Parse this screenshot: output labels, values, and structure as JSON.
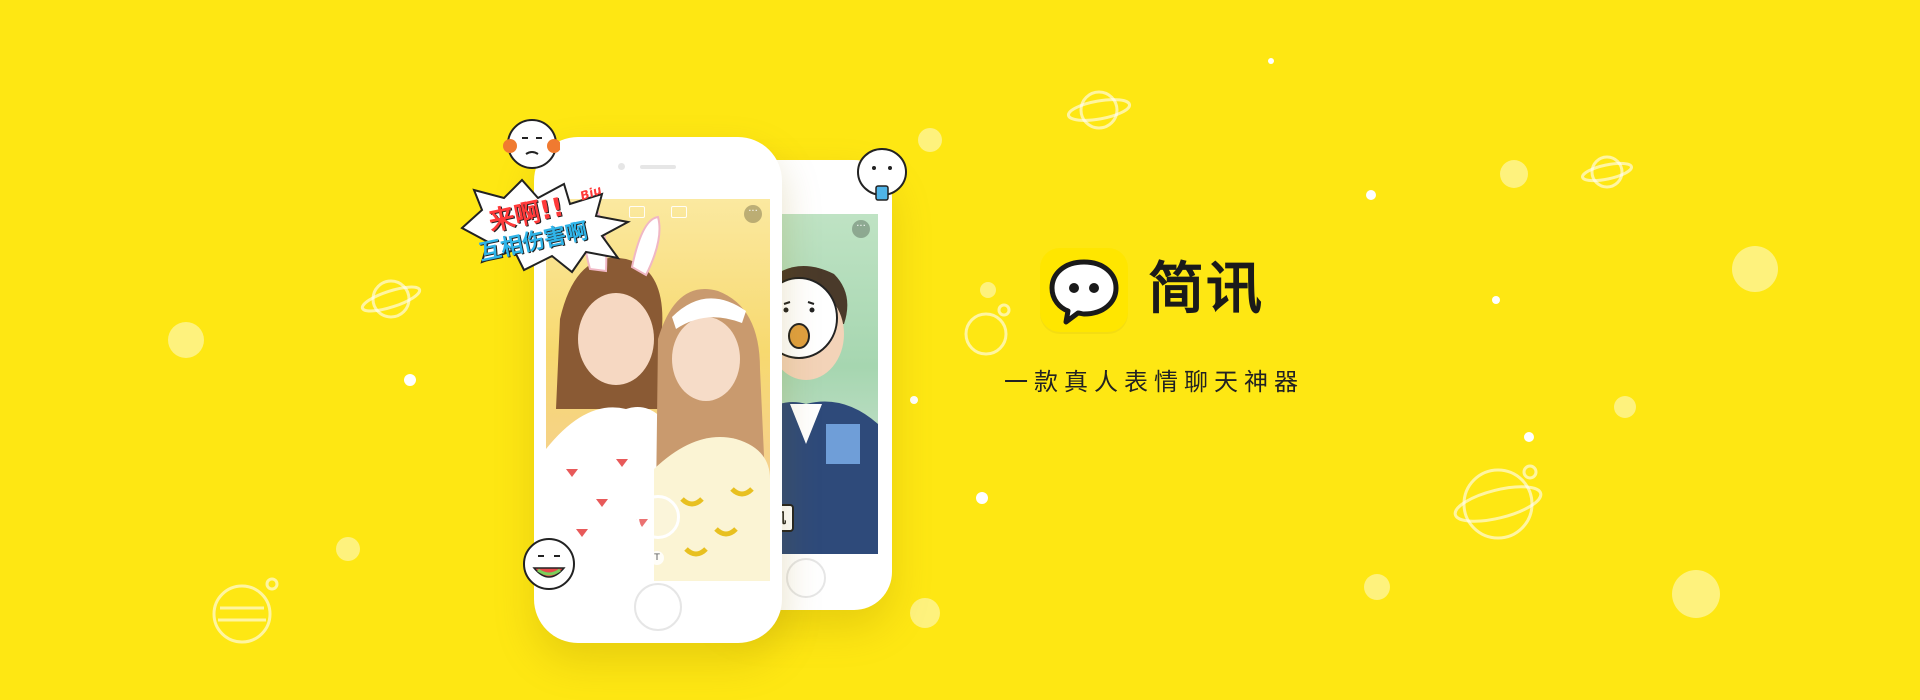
{
  "brand": {
    "app_name": "简讯",
    "slogan": "一款真人表情聊天神器"
  },
  "comic_sticker": {
    "line1": "来啊!!",
    "line2": "互相伤害啊",
    "tag": "Biu"
  },
  "back_phone_caption": "老司机",
  "colors": {
    "background": "#FEE713",
    "icon_bg": "#FFE600",
    "text": "#1a1a1a"
  },
  "icons": [
    "chat-bubble-icon",
    "planet-icon",
    "emoji-face-icon",
    "more-icon",
    "text-tool-icon"
  ]
}
